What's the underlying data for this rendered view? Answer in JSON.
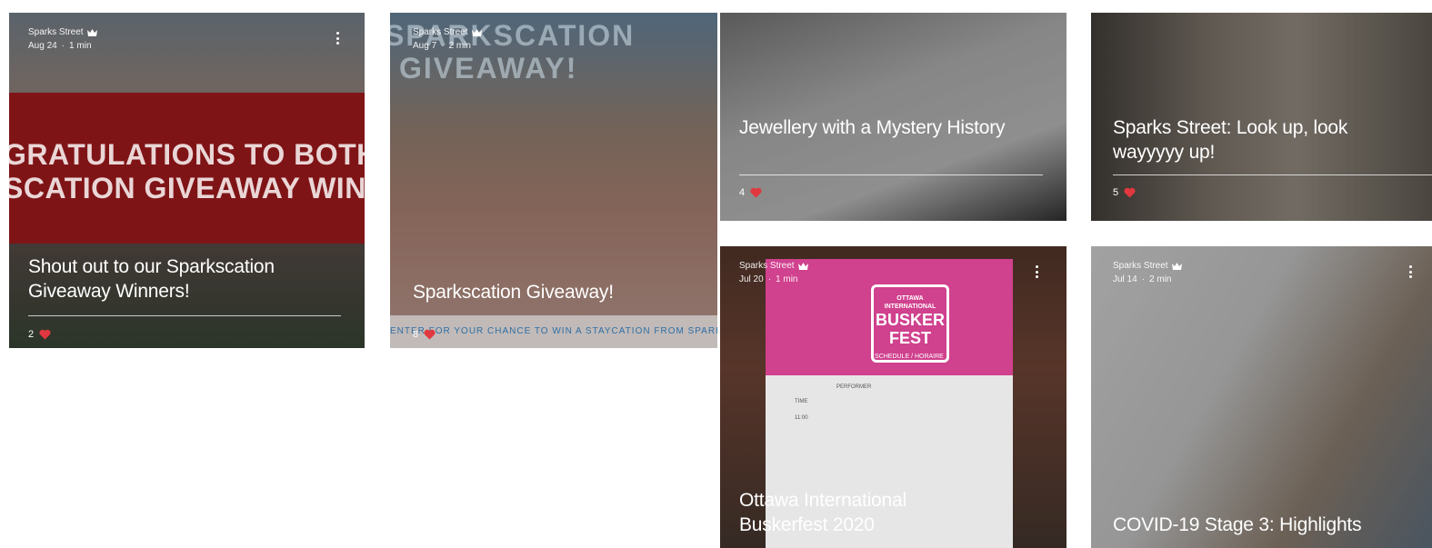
{
  "posts": [
    {
      "author": "Sparks Street",
      "date": "Aug 24",
      "read_time": "1 min",
      "title": "Shout out to our Sparkscation Giveaway Winners!",
      "likes": "2",
      "image_text_1": "GRATULATIONS TO BOTH",
      "image_text_2": "SCATION GIVEAWAY WIN"
    },
    {
      "author": "Sparks Street",
      "date": "Aug 7",
      "read_time": "2 min",
      "title": "Sparkscation Giveaway!",
      "likes": "8",
      "image_text_1": "SPARKSCATION",
      "image_text_2": "GIVEAWAY!",
      "image_text_3": "ENTER FOR YOUR CHANCE TO WIN A STAYCATION FROM SPARKS"
    },
    {
      "title": "Jewellery with a Mystery History",
      "likes": "4"
    },
    {
      "title": "Sparks Street: Look up, look wayyyyy up!",
      "likes": "5"
    },
    {
      "author": "Sparks Street",
      "date": "Jul 20",
      "read_time": "1 min",
      "title": "Ottawa International Buskerfest 2020",
      "image_text_1": "OTTAWA INTERNATIONAL",
      "image_text_2": "BUSKER FEST",
      "image_text_3": "SCHEDULE / HORAIRE",
      "image_text_4": "TIME",
      "image_text_5": "PERFORMER",
      "image_text_6": "11:00"
    },
    {
      "author": "Sparks Street",
      "date": "Jul 14",
      "read_time": "2 min",
      "title": "COVID-19 Stage 3: Highlights"
    }
  ],
  "colors": {
    "heart": "#e0383e",
    "banner_red": "#b01c21",
    "sign_pink": "#d0418e"
  },
  "icons": {
    "crown": "crown-icon",
    "more": "more-actions-icon",
    "heart": "heart-icon"
  }
}
